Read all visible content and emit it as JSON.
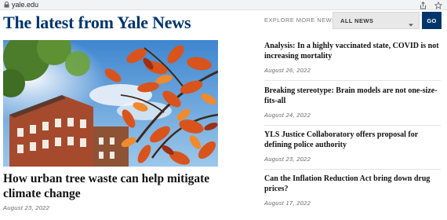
{
  "browser": {
    "url": "yale.edu",
    "icons": [
      "lock-icon",
      "share-icon",
      "star-icon"
    ]
  },
  "header": {
    "title": "The latest from Yale News",
    "explore_label": "EXPLORE MORE NEWS",
    "filter_value": "ALL NEWS",
    "go_label": "GO"
  },
  "feature": {
    "title": "How urban tree waste can help mitigate climate change",
    "date": "August 23, 2022"
  },
  "stories": [
    {
      "title": "Analysis: In a highly vaccinated state, COVID is not increasing mortality",
      "date": "August 26, 2022"
    },
    {
      "title": "Breaking stereotype: Brain models are not one-size-fits-all",
      "date": "August 24, 2022"
    },
    {
      "title": "YLS Justice Collaboratory offers proposal for defining police authority",
      "date": "August 23, 2022"
    },
    {
      "title": "Can the Inflation Reduction Act bring down drug prices?",
      "date": "August 17, 2022"
    }
  ],
  "colors": {
    "brand": "#00356b",
    "leaves": "#d8541c"
  }
}
